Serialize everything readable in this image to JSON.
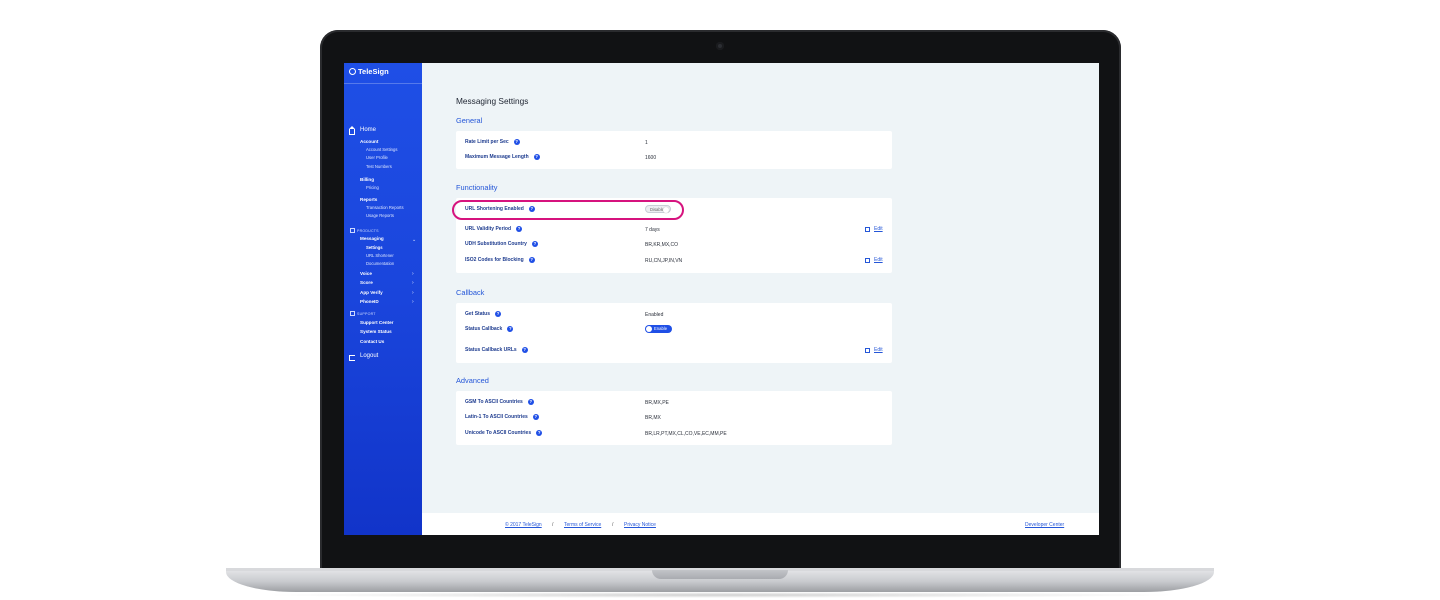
{
  "brand": {
    "name": "TeleSign"
  },
  "nav": {
    "home": "Home",
    "account": "Account",
    "account_settings": "Account Settings",
    "user_profile": "User Profile",
    "test_numbers": "Test Numbers",
    "billing": "Billing",
    "pricing": "Pricing",
    "reports": "Reports",
    "transaction_reports": "Transaction Reports",
    "usage_reports": "Usage Reports",
    "products_header": "PRODUCTS",
    "messaging": "Messaging",
    "settings": "Settings",
    "url_shortener": "URL Shortener",
    "documentation": "Documentation",
    "voice": "Voice",
    "score": "Score",
    "app_verify": "App Verify",
    "phoneid": "PhoneID",
    "support_header": "SUPPORT",
    "support_center": "Support Center",
    "system_status": "System Status",
    "contact_us": "Contact Us",
    "logout": "Logout"
  },
  "page": {
    "title": "Messaging Settings"
  },
  "sections": {
    "general": {
      "title": "General",
      "rows": [
        {
          "label": "Rate Limit per Sec",
          "value": "1"
        },
        {
          "label": "Maximum Message Length",
          "value": "1600"
        }
      ]
    },
    "functionality": {
      "title": "Functionality",
      "rows": [
        {
          "label": "URL Shortening Enabled",
          "toggle": "Disable"
        },
        {
          "label": "URL Validity Period",
          "value": "7 days",
          "edit": "Edit"
        },
        {
          "label": "UDH Substitution Country",
          "value": "BR,KR,MX,CO"
        },
        {
          "label": "ISO2 Codes for Blocking",
          "value": "RU,CN,JP,IN,VN",
          "edit": "Edit"
        }
      ]
    },
    "callback": {
      "title": "Callback",
      "rows": [
        {
          "label": "Get Status",
          "value": "Enabled"
        },
        {
          "label": "Status Callback",
          "toggle": "Enable"
        },
        {
          "label": "Status Callback URLs",
          "edit": "Edit"
        }
      ]
    },
    "advanced": {
      "title": "Advanced",
      "rows": [
        {
          "label": "GSM To ASCII Countries",
          "value": "BR,MX,PE"
        },
        {
          "label": "Latin-1 To ASCII Countries",
          "value": "BR,MX"
        },
        {
          "label": "Unicode To ASCII Countries",
          "value": "BR,LR,PT,MX,CL,CO,VE,EC,MM,PE"
        }
      ]
    }
  },
  "footer": {
    "copyright": "© 2017 TeleSign",
    "sep": "/",
    "terms": "Terms of Service",
    "privacy": "Privacy Notice",
    "developer": "Developer Center"
  },
  "colors": {
    "accent": "#1f4fe6",
    "highlight": "#d6137e",
    "background": "#eef4f7"
  },
  "icons": [
    "home-icon",
    "help-icon",
    "edit-icon",
    "logout-icon",
    "chevron-right-icon",
    "chevron-down-icon"
  ]
}
